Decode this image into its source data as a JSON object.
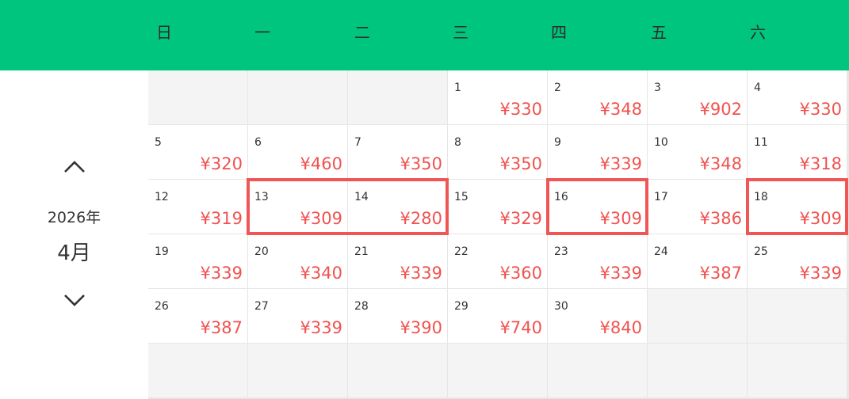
{
  "colors": {
    "accent": "#00c57f",
    "price": "#f0524f",
    "highlight": "#f05656"
  },
  "weekdays": [
    "日",
    "一",
    "二",
    "三",
    "四",
    "五",
    "六"
  ],
  "nav": {
    "year": "2026年",
    "month": "4月",
    "prev_icon": "chevron-up-icon",
    "next_icon": "chevron-down-icon"
  },
  "weeks": [
    [
      null,
      null,
      null,
      {
        "day": "1",
        "price": "¥330"
      },
      {
        "day": "2",
        "price": "¥348"
      },
      {
        "day": "3",
        "price": "¥902"
      },
      {
        "day": "4",
        "price": "¥330"
      }
    ],
    [
      {
        "day": "5",
        "price": "¥320"
      },
      {
        "day": "6",
        "price": "¥460"
      },
      {
        "day": "7",
        "price": "¥350"
      },
      {
        "day": "8",
        "price": "¥350"
      },
      {
        "day": "9",
        "price": "¥339"
      },
      {
        "day": "10",
        "price": "¥348"
      },
      {
        "day": "11",
        "price": "¥318"
      }
    ],
    [
      {
        "day": "12",
        "price": "¥319"
      },
      {
        "day": "13",
        "price": "¥309"
      },
      {
        "day": "14",
        "price": "¥280"
      },
      {
        "day": "15",
        "price": "¥329"
      },
      {
        "day": "16",
        "price": "¥309"
      },
      {
        "day": "17",
        "price": "¥386"
      },
      {
        "day": "18",
        "price": "¥309"
      }
    ],
    [
      {
        "day": "19",
        "price": "¥339"
      },
      {
        "day": "20",
        "price": "¥340"
      },
      {
        "day": "21",
        "price": "¥339"
      },
      {
        "day": "22",
        "price": "¥360"
      },
      {
        "day": "23",
        "price": "¥339"
      },
      {
        "day": "24",
        "price": "¥387"
      },
      {
        "day": "25",
        "price": "¥339"
      }
    ],
    [
      {
        "day": "26",
        "price": "¥387"
      },
      {
        "day": "27",
        "price": "¥339"
      },
      {
        "day": "28",
        "price": "¥390"
      },
      {
        "day": "29",
        "price": "¥740"
      },
      {
        "day": "30",
        "price": "¥840"
      },
      null,
      null
    ],
    [
      null,
      null,
      null,
      null,
      null,
      null,
      null
    ]
  ],
  "highlighted_days": [
    "13",
    "14",
    "16",
    "18"
  ]
}
